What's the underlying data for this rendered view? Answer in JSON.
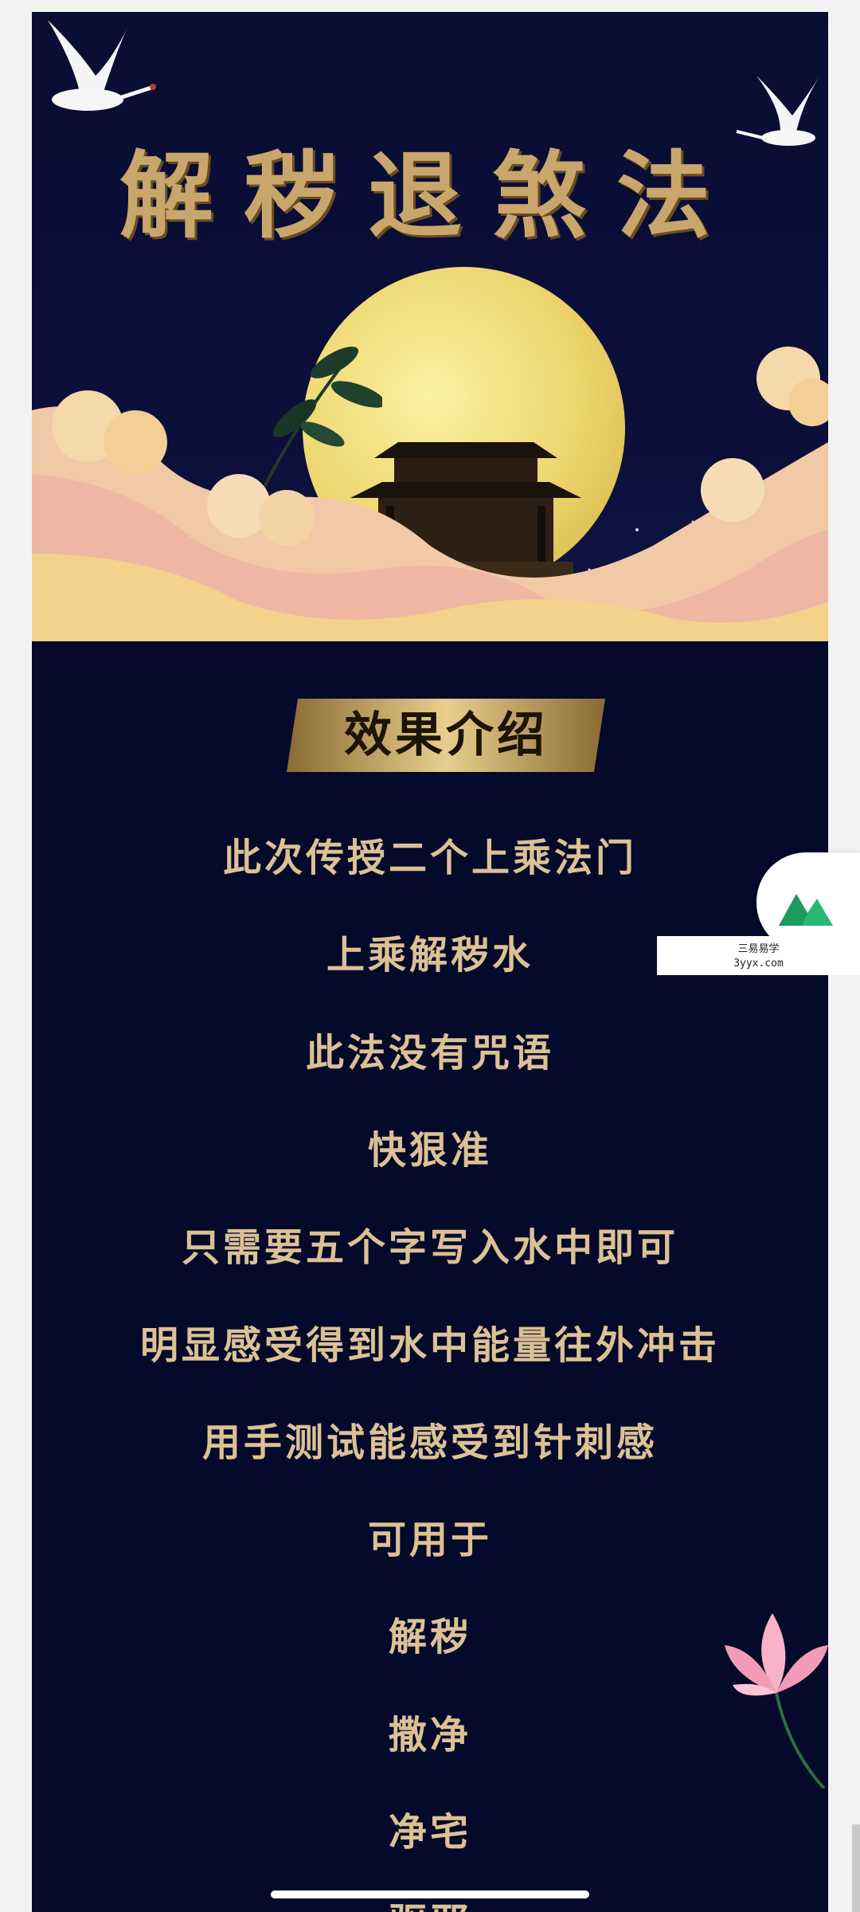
{
  "poster": {
    "title": "解秽退煞法",
    "section_heading": "效果介绍",
    "lines": [
      "此次传授二个上乘法门",
      "上乘解秽水",
      "此法没有咒语",
      "快狠准",
      "只需要五个字写入水中即可",
      "明显感受得到水中能量往外冲击",
      "用手测试能感受到针刺感",
      "可用于",
      "解秽",
      "撒净",
      "净宅",
      "驱邪"
    ]
  },
  "widget": {
    "name": "三易易学",
    "url": "3yyx.com",
    "icon": "mountain-logo-icon",
    "accent_color": "#2bb673"
  },
  "colors": {
    "background": "#05092a",
    "text_gold": "#dcc194",
    "title_gold": "#c9a66b"
  }
}
